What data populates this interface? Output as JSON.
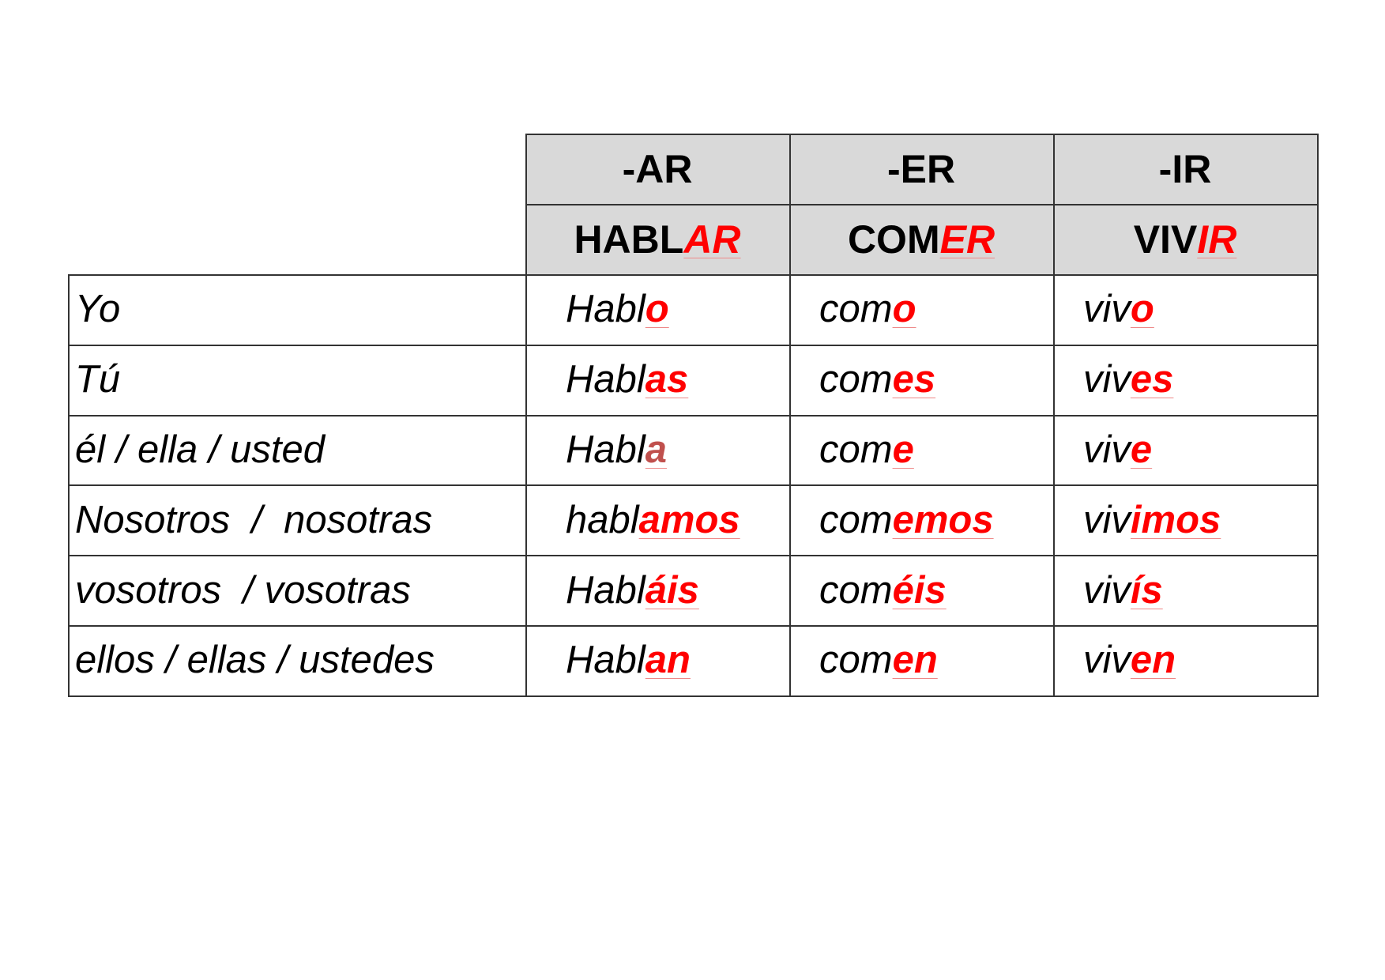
{
  "table": {
    "groups": [
      "-AR",
      "-ER",
      "-IR"
    ],
    "verbs": [
      {
        "stem": "HABL",
        "ending": "AR"
      },
      {
        "stem": "COM",
        "ending": "ER"
      },
      {
        "stem": "VIV",
        "ending": "IR"
      }
    ],
    "rows": [
      {
        "pronoun": "Yo",
        "forms": [
          {
            "stem": "Habl",
            "ending": "o"
          },
          {
            "stem": "com",
            "ending": "o"
          },
          {
            "stem": "viv",
            "ending": "o"
          }
        ]
      },
      {
        "pronoun": "Tú",
        "forms": [
          {
            "stem": "Habl",
            "ending": "as"
          },
          {
            "stem": "com",
            "ending": "es"
          },
          {
            "stem": "viv",
            "ending": "es"
          }
        ]
      },
      {
        "pronoun": "él / ella / usted",
        "forms": [
          {
            "stem": "Habl",
            "ending": "a"
          },
          {
            "stem": "com",
            "ending": "e"
          },
          {
            "stem": "viv",
            "ending": "e"
          }
        ]
      },
      {
        "pronoun": "Nosotros  /  nosotras",
        "forms": [
          {
            "stem": "habl",
            "ending": "amos"
          },
          {
            "stem": "com",
            "ending": "emos"
          },
          {
            "stem": "viv",
            "ending": "imos"
          }
        ]
      },
      {
        "pronoun": "vosotros  / vosotras",
        "forms": [
          {
            "stem": "Habl",
            "ending": "áis"
          },
          {
            "stem": "com",
            "ending": "éis"
          },
          {
            "stem": "viv",
            "ending": "ís"
          }
        ]
      },
      {
        "pronoun": "ellos / ellas / ustedes",
        "forms": [
          {
            "stem": "Habl",
            "ending": "an"
          },
          {
            "stem": "com",
            "ending": "en"
          },
          {
            "stem": "viv",
            "ending": "en"
          }
        ]
      }
    ]
  },
  "colors": {
    "ending": "#ff0000",
    "ending_muted": "#c0504d",
    "header_bg": "#d9d9d9"
  }
}
